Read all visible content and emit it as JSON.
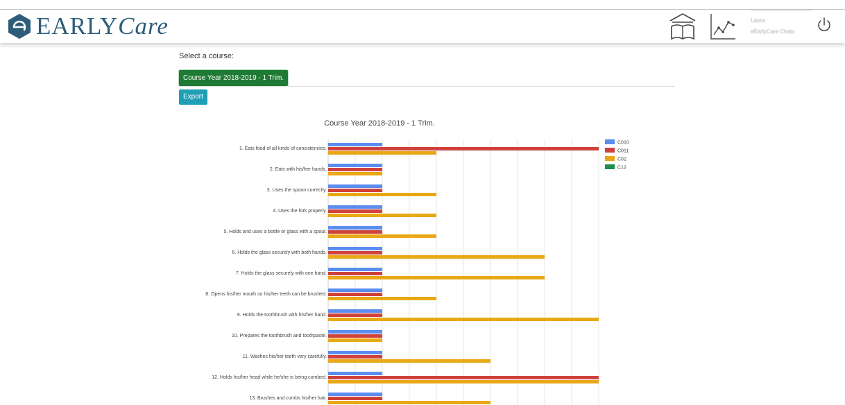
{
  "header": {
    "logo": "eARLYCare",
    "logo_prefix": "EARLY",
    "logo_suffix": "Care",
    "user_name": "Laura",
    "user_role": "eEarlyCare Chato",
    "icons": [
      "home-book-icon",
      "chart-line-icon",
      "power-icon"
    ]
  },
  "course": {
    "select_label": "Select a course:",
    "selected": "Course Year 2018-2019 - 1 Trim.",
    "selected_color": "#1e7a34"
  },
  "export_label": "Export",
  "export_color": "#1e9fb4",
  "chart_data": {
    "type": "bar",
    "orientation": "horizontal",
    "title": "Course Year 2018-2019 - 1 Trim.",
    "categories": [
      "1. Eats food of all kinds of consistencies.",
      "2. Eats with his/her hands.",
      "3. Uses the spoon correctly.",
      "4. Uses the fork properly.",
      "5. Holds and uses a bottle or glass with a spout.",
      "6. Holds the glass securely with both hands.",
      "7. Holds the glass securely with one hand.",
      "8. Opens his/her mouth so his/her teeth can be brushed.",
      "9. Holds the toothbrush with his/her hand.",
      "10. Prepares the toothbrush and toothpaste.",
      "11. Washes his/her teeth very carefully.",
      "12. Holds his/her head while he/she is being combed.",
      "13. Brushes and combs his/her hair."
    ],
    "series": [
      {
        "name": "C010",
        "color": "#5b8def",
        "values": [
          2,
          2,
          2,
          2,
          2,
          2,
          2,
          2,
          2,
          2,
          2,
          2,
          2
        ]
      },
      {
        "name": "C011",
        "color": "#d0413b",
        "values": [
          10,
          2,
          2,
          2,
          2,
          2,
          2,
          2,
          2,
          2,
          2,
          10,
          2
        ]
      },
      {
        "name": "C02",
        "color": "#e9a816",
        "values": [
          4,
          2,
          4,
          4,
          4,
          8,
          8,
          4,
          10,
          2,
          6,
          10,
          6
        ]
      },
      {
        "name": "C12",
        "color": "#1e8f4e",
        "values": [
          0,
          0,
          0,
          0,
          0,
          0,
          0,
          0,
          0,
          0,
          0,
          0,
          0
        ]
      }
    ],
    "xlim": [
      0,
      10
    ],
    "grid": true,
    "legend": "right"
  }
}
